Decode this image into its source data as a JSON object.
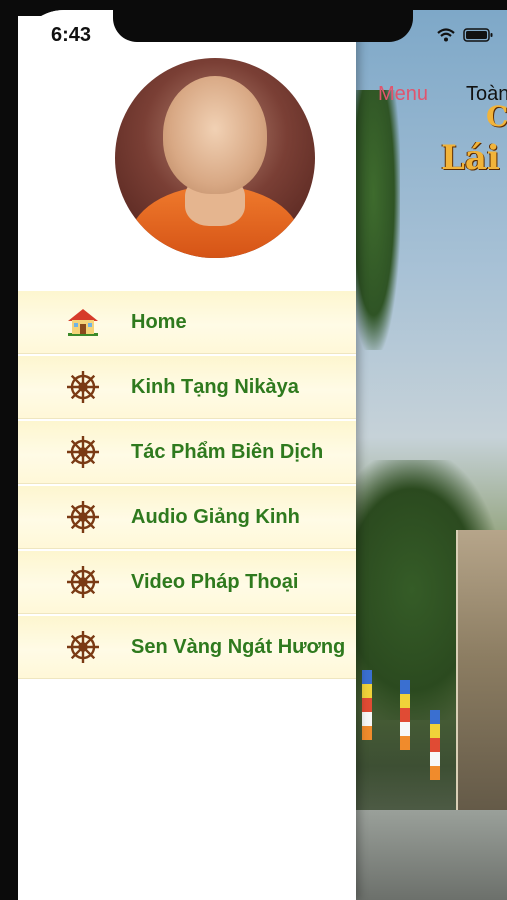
{
  "status_bar": {
    "time": "6:43"
  },
  "background_page": {
    "menu_label": "Menu",
    "toolbar_text": "Toàn",
    "title_fragment_top": "C",
    "title_fragment": "Lái"
  },
  "drawer": {
    "avatar_alt": "avatar",
    "items": [
      {
        "label": "Home",
        "icon": "house-icon"
      },
      {
        "label": "Kinh Tạng Nikàya",
        "icon": "dharma-wheel-icon"
      },
      {
        "label": "Tác Phẩm Biên Dịch",
        "icon": "dharma-wheel-icon"
      },
      {
        "label": "Audio Giảng Kinh",
        "icon": "dharma-wheel-icon"
      },
      {
        "label": "Video Pháp Thoại",
        "icon": "dharma-wheel-icon"
      },
      {
        "label": "Sen Vàng Ngát Hương",
        "icon": "dharma-wheel-icon"
      }
    ]
  },
  "colors": {
    "menu_label_text": "#2f7a1e",
    "menu_item_bg": "#fdf6cf",
    "wheel_icon": "#7a3a14",
    "accent_menu": "#e0556e"
  }
}
